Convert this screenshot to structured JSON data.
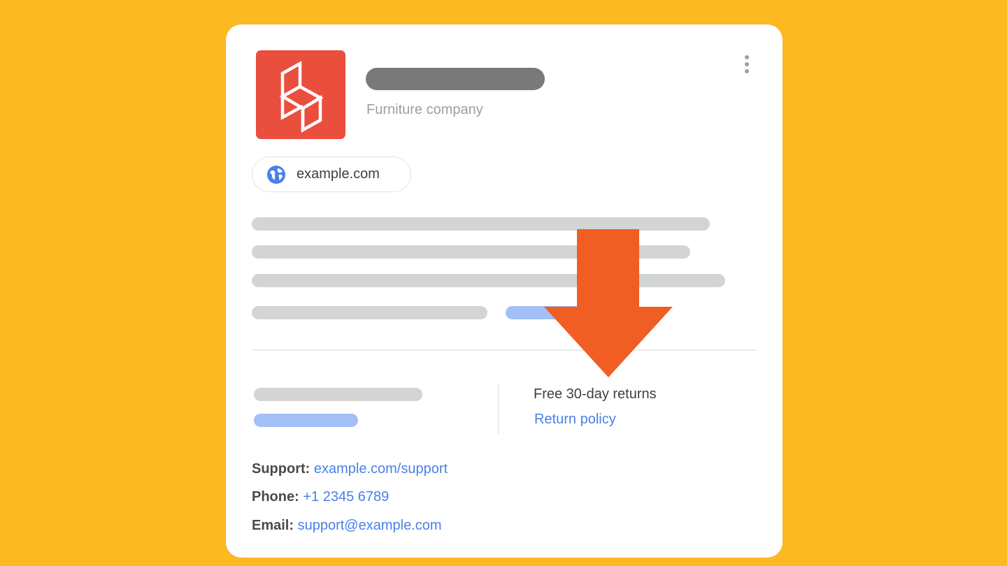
{
  "business": {
    "logo_icon": "chair-icon",
    "category": "Furniture company",
    "menu_icon": "more-vert-icon"
  },
  "website_chip": {
    "icon": "globe-icon",
    "label": "example.com"
  },
  "returns": {
    "title": "Free 30-day returns",
    "link": "Return policy"
  },
  "contacts": [
    {
      "label": "Support:",
      "value": "example.com/support"
    },
    {
      "label": "Phone:",
      "value": "+1 2345 6789"
    },
    {
      "label": "Email:",
      "value": "support@example.com"
    }
  ],
  "annotation": {
    "icon": "arrow-down-icon"
  },
  "colors": {
    "background": "#FDB922",
    "logo": "#EA4E3D",
    "link": "#4A80E8",
    "arrow": "#F05E23",
    "placeholder_gray": "#D3D4D4",
    "placeholder_blue": "#A2BFF6"
  }
}
